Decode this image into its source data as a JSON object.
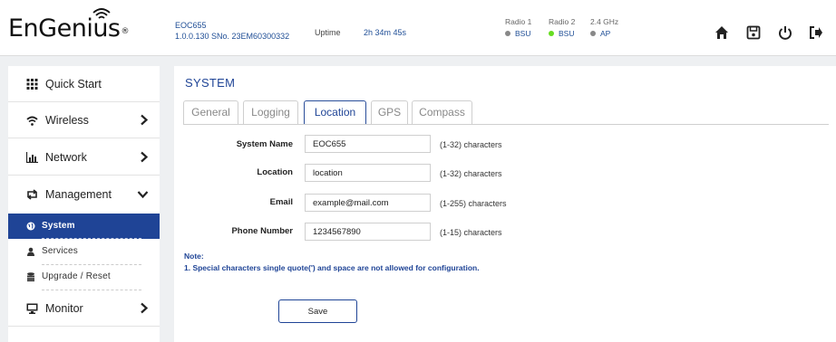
{
  "header": {
    "logo_text": "EnGenius",
    "logo_mark": "®",
    "model": "EOC655",
    "firmware_serial": "1.0.0.130 SNo. 23EM60300332",
    "uptime_label": "Uptime",
    "uptime_value": "2h 34m 45s",
    "radios": [
      {
        "label": "Radio 1",
        "status": "BSU",
        "dot_color": "#888888"
      },
      {
        "label": "Radio 2",
        "status": "BSU",
        "dot_color": "#66dd22"
      },
      {
        "label": "2.4 GHz",
        "status": "AP",
        "dot_color": "#888888"
      }
    ],
    "icons": [
      "home-icon",
      "save-icon",
      "power-icon",
      "logout-icon"
    ]
  },
  "sidebar": {
    "items": [
      {
        "label": "Quick Start",
        "icon": "grid-icon"
      },
      {
        "label": "Wireless",
        "icon": "wifi-icon"
      },
      {
        "label": "Network",
        "icon": "bar-chart-icon"
      },
      {
        "label": "Management",
        "icon": "retweet-icon"
      },
      {
        "label": "Monitor",
        "icon": "monitor-icon"
      }
    ],
    "sub_items": [
      {
        "label": "System",
        "icon": "globe-icon",
        "active": true
      },
      {
        "label": "Services",
        "icon": "user-icon"
      },
      {
        "label": "Upgrade / Reset",
        "icon": "database-icon"
      }
    ]
  },
  "main": {
    "title": "SYSTEM",
    "tabs": [
      "General",
      "Logging",
      "Location",
      "GPS",
      "Compass"
    ],
    "active_tab": "Location",
    "fields": [
      {
        "label": "System Name",
        "value": "EOC655",
        "hint": "(1-32) characters"
      },
      {
        "label": "Location",
        "value": "location",
        "hint": "(1-32) characters"
      },
      {
        "label": "Email",
        "value": "example@mail.com",
        "hint": "(1-255) characters"
      },
      {
        "label": "Phone Number",
        "value": "1234567890",
        "hint": "(1-15) characters"
      }
    ],
    "note_title": "Note:",
    "note_text": "1. Special characters single quote(') and space are not allowed for configuration.",
    "save_label": "Save"
  },
  "colors": {
    "accent": "#1f4496",
    "link": "#1f4e96",
    "radio_active": "#66dd22"
  }
}
